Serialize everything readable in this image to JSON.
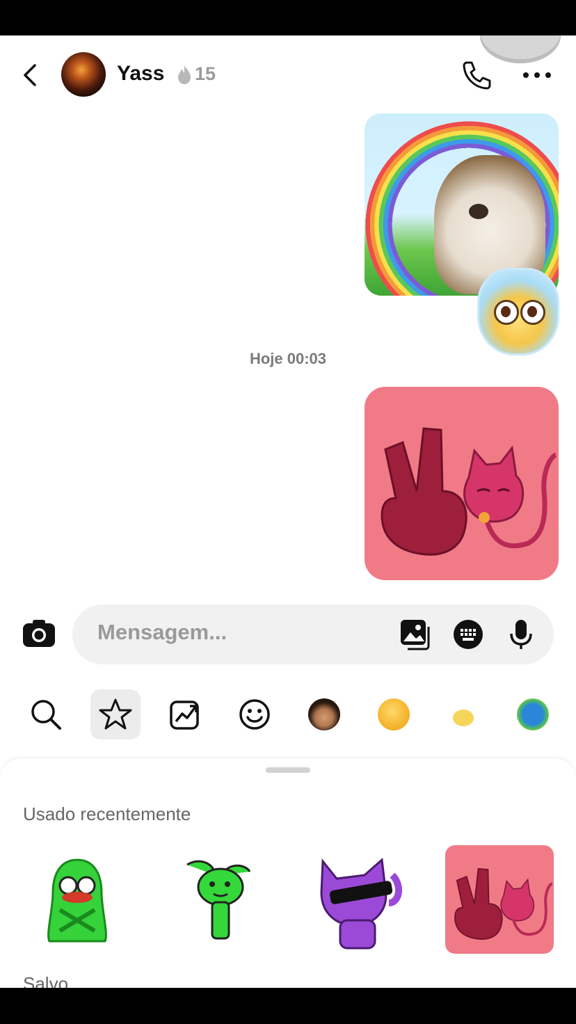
{
  "header": {
    "contact_name": "Yass",
    "streak_count": "15",
    "icons": {
      "back": "chevron-left-icon",
      "call": "phone-icon",
      "more": "more-horizontal-icon",
      "streak": "flame-icon"
    }
  },
  "conversation": {
    "timestamp": "Hoje 00:03"
  },
  "composer": {
    "placeholder": "Mensagem..."
  },
  "tray": {
    "items": [
      "search-icon",
      "star-icon",
      "trending-icon",
      "smiley-icon",
      "avatar-face",
      "wink-emoji",
      "sticker-sun",
      "sticker-blue-creature"
    ],
    "selected": "star-icon"
  },
  "sticker_sheet": {
    "section_recent": "Usado recentemente",
    "section_next": "Salvo"
  },
  "colors": {
    "sticker_pink_bg": "#f07a86",
    "sticker_hand": "#a01f3c"
  }
}
